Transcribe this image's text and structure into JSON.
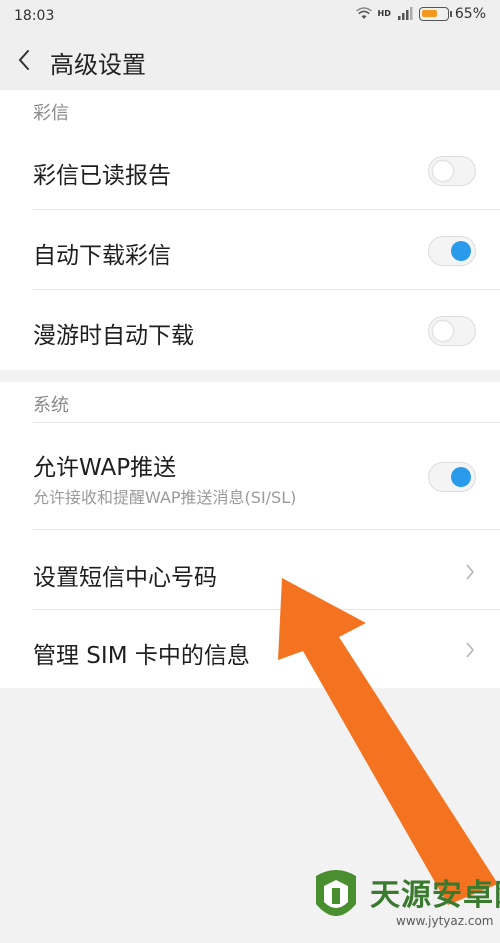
{
  "status_bar": {
    "time": "18:03",
    "network_label": "HD",
    "battery_percent_text": "65%",
    "battery_level": 0.65,
    "battery_color": "#f39a1e"
  },
  "header": {
    "title": "高级设置",
    "back_icon": "chevron-left-icon"
  },
  "sections": [
    {
      "header": "彩信",
      "items": [
        {
          "title": "彩信已读报告",
          "control": "toggle",
          "checked": false
        },
        {
          "title": "自动下载彩信",
          "control": "toggle",
          "checked": true
        },
        {
          "title": "漫游时自动下载",
          "control": "toggle",
          "checked": false
        }
      ]
    },
    {
      "header": "系统",
      "items": [
        {
          "title": "允许WAP推送",
          "subtitle": "允许接收和提醒WAP推送消息(SI/SL)",
          "control": "toggle",
          "checked": true
        },
        {
          "title": "设置短信中心号码",
          "control": "chevron"
        },
        {
          "title": "管理 SIM 卡中的信息",
          "control": "chevron"
        }
      ]
    }
  ],
  "overlay": {
    "arrow_color": "#f47321",
    "arrow_icon": "pointing-arrow-icon"
  },
  "watermark": {
    "name": "天源安卓网",
    "url": "www.jytyaz.com"
  },
  "colors": {
    "toggle_on": "#2a9bea",
    "background": "#f2f2f2"
  }
}
